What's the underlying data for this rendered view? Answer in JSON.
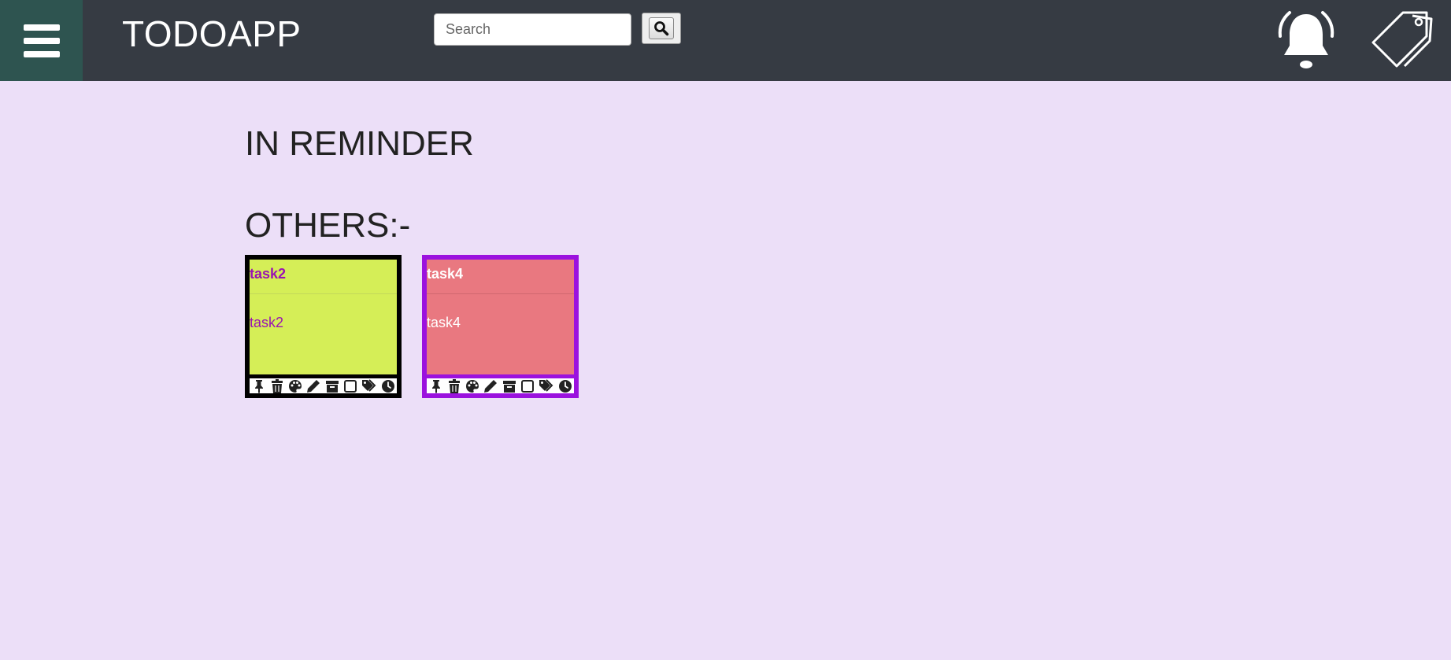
{
  "header": {
    "app_title": "TODOAPP",
    "menu_icon": "hamburger-menu-icon",
    "search": {
      "placeholder": "Search",
      "value": ""
    },
    "search_button_icon": "search-icon",
    "notifications_icon": "bell-icon",
    "labels_icon": "tag-icon",
    "colors": {
      "topbar": "#363b43",
      "menu_button": "#2e5450"
    }
  },
  "main": {
    "background": "#ecdff8",
    "reminder_heading": "IN REMINDER",
    "others_heading": "OTHERS:-"
  },
  "notes": [
    {
      "title": "task2",
      "content": "task2",
      "background": "#d5ee57",
      "border_color": "#000000",
      "text_color": "#9a13b3",
      "toolbar_icons": [
        "pin-icon",
        "trash-icon",
        "palette-icon",
        "pencil-icon",
        "archive-icon",
        "checkbox-icon",
        "tags-icon",
        "clock-icon"
      ]
    },
    {
      "title": "task4",
      "content": "task4",
      "background": "#e97880",
      "border_color": "#9b12de",
      "text_color": "#ffffff",
      "toolbar_icons": [
        "pin-icon",
        "trash-icon",
        "palette-icon",
        "pencil-icon",
        "archive-icon",
        "checkbox-icon",
        "tags-icon",
        "clock-icon"
      ]
    }
  ]
}
